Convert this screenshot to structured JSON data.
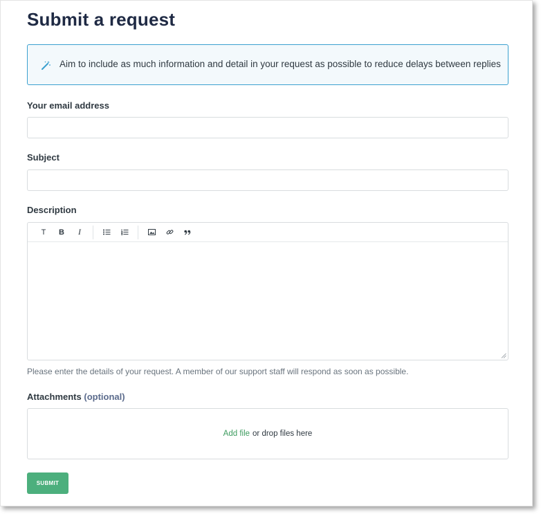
{
  "page": {
    "title": "Submit a request"
  },
  "notice": {
    "icon": "magic-wand-icon",
    "text": "Aim to include as much information and detail in your request as possible to reduce delays between replies"
  },
  "form": {
    "email_label": "Your email address",
    "email_value": "",
    "subject_label": "Subject",
    "subject_value": "",
    "description_label": "Description",
    "description_hint": "Please enter the details of your request. A member of our support staff will respond as soon as possible.",
    "toolbar": {
      "text_label": "T",
      "bold_label": "B",
      "italic_label": "I",
      "icons": [
        "bulleted-list-icon",
        "numbered-list-icon",
        "image-icon",
        "link-icon",
        "quote-icon"
      ]
    },
    "attachments_label": "Attachments",
    "attachments_optional": "(optional)",
    "add_file_link": "Add file",
    "drop_text": "or drop files here",
    "submit_label": "SUBMIT"
  },
  "colors": {
    "title": "#1f2a44",
    "notice_border": "#3aa0cf",
    "notice_bg": "#f3f9fc",
    "accent_green": "#4caf7d",
    "link_green": "#3d9b5f"
  }
}
